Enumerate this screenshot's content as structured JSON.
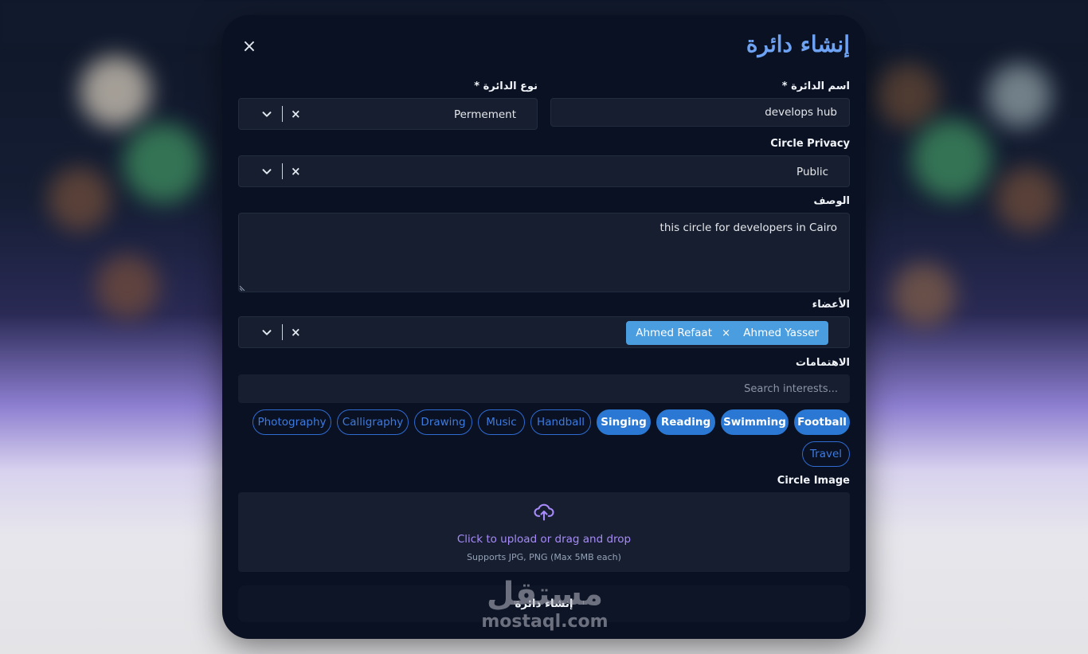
{
  "modal": {
    "title": "إنشاء دائرة",
    "close_label": "×"
  },
  "form": {
    "name": {
      "label": "اسم الدائرة *",
      "value": "develops hub"
    },
    "type": {
      "label": "نوع الدائرة *",
      "value": "Permement"
    },
    "privacy": {
      "label": "Circle Privacy",
      "value": "Public"
    },
    "description": {
      "label": "الوصف",
      "value": "this circle for developers in Cairo"
    },
    "members": {
      "label": "الأعضاء",
      "chips": [
        {
          "label": "Ahmed Yasser",
          "remove": "×"
        },
        {
          "label": "Ahmed Refaat"
        }
      ]
    },
    "interests": {
      "label": "الاهتمامات",
      "placeholder": "Search interests...",
      "tags": [
        {
          "label": "Football",
          "selected": true
        },
        {
          "label": "Swimming",
          "selected": true
        },
        {
          "label": "Reading",
          "selected": true
        },
        {
          "label": "Singing",
          "selected": true
        },
        {
          "label": "Handball",
          "selected": false
        },
        {
          "label": "Music",
          "selected": false
        },
        {
          "label": "Drawing",
          "selected": false
        },
        {
          "label": "Calligraphy",
          "selected": false
        },
        {
          "label": "Photography",
          "selected": false
        },
        {
          "label": "Travel",
          "selected": false
        }
      ]
    },
    "image": {
      "label": "Circle Image",
      "upload_text": "Click to upload or drag and drop",
      "hint": "Supports JPG, PNG (Max 5MB each)"
    },
    "submit_label": "إنشاء دائرة"
  },
  "clear_symbol": "×",
  "watermark": {
    "arabic": "مستقل",
    "latin": "mostaql.com"
  },
  "colors": {
    "accent": "#2a78d3",
    "chip": "#4a9ee0",
    "title": "#6ea2f2",
    "modal_bg": "#0a1122"
  }
}
